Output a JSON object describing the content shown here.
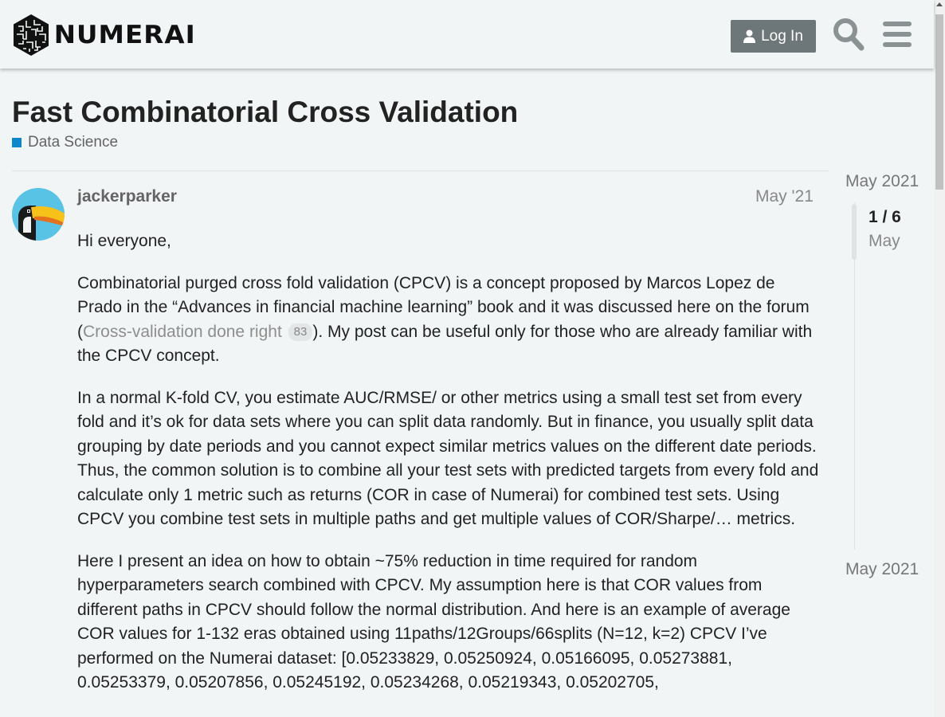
{
  "header": {
    "brand": "NUMERAI",
    "login_label": "Log In"
  },
  "topic": {
    "title": "Fast Combinatorial Cross Validation",
    "category": "Data Science",
    "category_color": "#0e86ca"
  },
  "post": {
    "username": "jackerparker",
    "date": "May '21",
    "greeting": "Hi everyone,",
    "p1_before": "Combinatorial purged cross fold validation (CPCV) is a concept proposed by Marcos Lopez de Prado in the “Advances in financial machine learning” book and it was discussed here on the forum (",
    "p1_link": "Cross-validation done right",
    "p1_link_clicks": "83",
    "p1_after": "). My post can be useful only for those who are already familiar with the CPCV concept.",
    "p2": "In a normal K-fold CV, you estimate AUC/RMSE/ or other metrics using a small test set from every fold and it’s ok for data sets where you can split data randomly. But in finance, you usually split data grouping by date periods and you cannot expect similar metrics values on the different date periods. Thus, the common solution is to combine all your test sets with predicted targets from every fold and calculate only 1 metric such as returns (COR in case of Numerai) for combined test sets. Using CPCV you combine test sets in multiple paths and get multiple values of COR/Sharpe/… metrics.",
    "p3": "Here I present an idea on how to obtain ~75% reduction in time required for random hyperparameters search combined with CPCV. My assumption here is that COR values from different paths in CPCV should follow the normal distribution. And here is an example of average COR values for 1-132 eras obtained using 11paths/12Groups/66splits (N=12, k=2) CPCV I’ve performed on the Numerai dataset: [0.05233829, 0.05250924, 0.05166095, 0.05273881, 0.05253379, 0.05207856, 0.05245192, 0.05234268, 0.05219343, 0.05202705,"
  },
  "timeline": {
    "start_date": "May 2021",
    "position": "1 / 6",
    "current_month": "May",
    "end_date": "May 2021"
  }
}
